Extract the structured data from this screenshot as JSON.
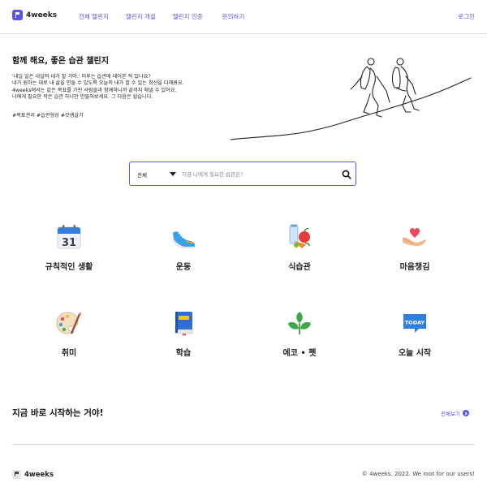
{
  "header": {
    "logo_text": "4weeks",
    "nav": [
      "전체 챌린지",
      "챌린지 개설",
      "챌린지 인증",
      "문의하기"
    ],
    "login": "로그인"
  },
  "hero": {
    "title": "함께 해요, 좋은 습관 챌린지",
    "description": [
      "'내일 일은 내일의 내가 할 거야.' 미루는 습관에 데어본 적 있나요?",
      "내가 원하는 대로 내 삶을 만들 수 있도록 오늘의 내가 할 수 있는 최선을 다해봐요.",
      "4weeks에서는 같은 목표를 가진 사람들과 함께하니까 끝까지 해낼 수 있어요.",
      "나에게 필요한 작은 습관 하나만 만들어보세요. 그 다음은 쉽습니다."
    ],
    "tags": "#목표관리 #습관형성 #갓생살기"
  },
  "search": {
    "selected": "전체",
    "placeholder": "지금 나에게 필요한 습관은?"
  },
  "categories": [
    {
      "label": "규칙적인 생활",
      "icon": "calendar-icon"
    },
    {
      "label": "운동",
      "icon": "sneaker-icon"
    },
    {
      "label": "식습관",
      "icon": "healthy-food-icon"
    },
    {
      "label": "마음챙김",
      "icon": "heart-hands-icon"
    },
    {
      "label": "취미",
      "icon": "palette-icon"
    },
    {
      "label": "학습",
      "icon": "book-icon"
    },
    {
      "label": "에코 • 펫",
      "icon": "leaf-icon"
    },
    {
      "label": "오늘 시작",
      "icon": "today-icon"
    }
  ],
  "cta": {
    "title": "지금 바로 시작하는 거야!",
    "link": "전체보기"
  },
  "footer": {
    "logo_text": "4weeks",
    "copyright": "© 4weeks. 2022. We root for our users!"
  },
  "colors": {
    "accent": "#5a55e6"
  }
}
